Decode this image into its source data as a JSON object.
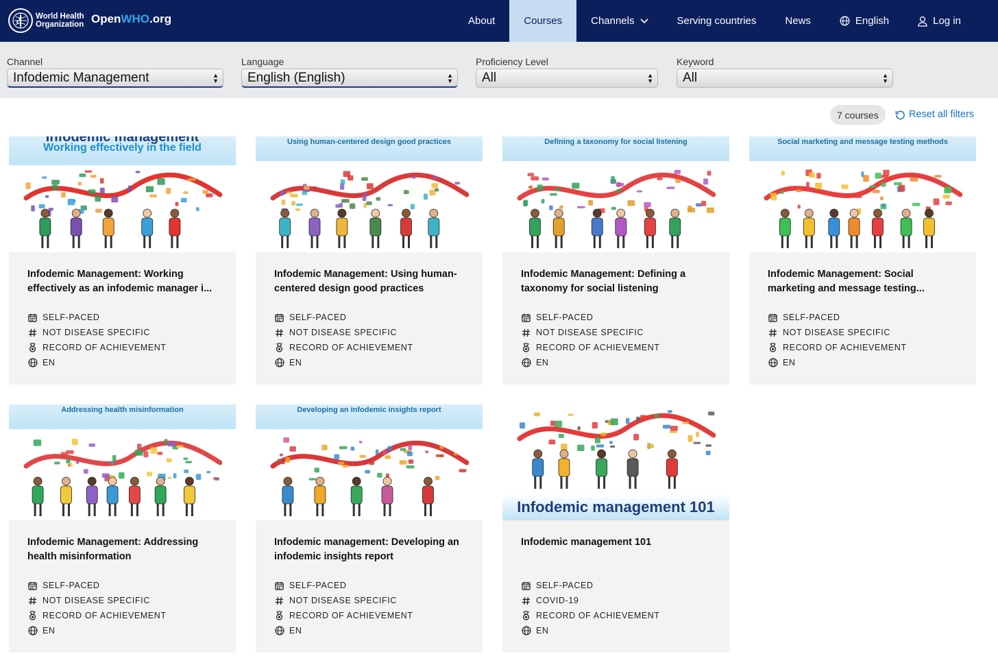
{
  "header": {
    "org_name_line1": "World Health",
    "org_name_line2": "Organization",
    "brand_prefix": "Open",
    "brand_who": "WHO",
    "brand_suffix": ".org",
    "nav": {
      "about": "About",
      "courses": "Courses",
      "channels": "Channels",
      "serving_countries": "Serving countries",
      "news": "News",
      "language": "English",
      "login": "Log in"
    }
  },
  "filters": {
    "channel": {
      "label": "Channel",
      "value": "Infodemic Management"
    },
    "language": {
      "label": "Language",
      "value": "English (English)"
    },
    "proficiency": {
      "label": "Proficiency Level",
      "value": "All"
    },
    "keyword": {
      "label": "Keyword",
      "value": "All"
    }
  },
  "results": {
    "count": "7 courses",
    "reset": "Reset all filters"
  },
  "courses": [
    {
      "thumb_caption_top": "Infodemic management",
      "thumb_caption": "Working effectively in the field",
      "title": "Infodemic Management: Working effectively as an infodemic manager i...",
      "pace": "SELF-PACED",
      "topic": "NOT DISEASE SPECIFIC",
      "award": "RECORD OF ACHIEVEMENT",
      "lang": "EN"
    },
    {
      "thumb_caption": "Using human-centered design good practices",
      "title": "Infodemic Management: Using human-centered design good practices",
      "pace": "SELF-PACED",
      "topic": "NOT DISEASE SPECIFIC",
      "award": "RECORD OF ACHIEVEMENT",
      "lang": "EN"
    },
    {
      "thumb_caption": "Defining a taxonomy for social listening",
      "title": "Infodemic Management: Defining a taxonomy for social listening",
      "pace": "SELF-PACED",
      "topic": "NOT DISEASE SPECIFIC",
      "award": "RECORD OF ACHIEVEMENT",
      "lang": "EN"
    },
    {
      "thumb_caption": "Social marketing and message testing methods",
      "title": "Infodemic Management: Social marketing and message testing...",
      "pace": "SELF-PACED",
      "topic": "NOT DISEASE SPECIFIC",
      "award": "RECORD OF ACHIEVEMENT",
      "lang": "EN"
    },
    {
      "thumb_caption": "Addressing health misinformation",
      "title": "Infodemic Management: Addressing health misinformation",
      "pace": "SELF-PACED",
      "topic": "NOT DISEASE SPECIFIC",
      "award": "RECORD OF ACHIEVEMENT",
      "lang": "EN"
    },
    {
      "thumb_caption": "Developing an infodemic insights report",
      "title": "Infodemic management: Developing an infodemic insights report",
      "pace": "SELF-PACED",
      "topic": "NOT DISEASE SPECIFIC",
      "award": "RECORD OF ACHIEVEMENT",
      "lang": "EN"
    },
    {
      "thumb_caption": "Infodemic management 101",
      "title": "Infodemic management 101",
      "pace": "SELF-PACED",
      "topic": "COVID-19",
      "award": "RECORD OF ACHIEVEMENT",
      "lang": "EN"
    }
  ],
  "icons": {
    "logo": "who-emblem-icon",
    "language": "globe-icon",
    "login": "user-icon",
    "channels": "chevron-down-icon",
    "reset": "reset-icon",
    "pace": "calendar-icon",
    "topic": "hash-icon",
    "award": "medal-icon",
    "lang": "globe-icon"
  },
  "colors": {
    "header_bg": "#0b1f5c",
    "active_nav": "#c6ddf1",
    "link": "#1a73c7",
    "card_bg": "#f3f3f3"
  }
}
